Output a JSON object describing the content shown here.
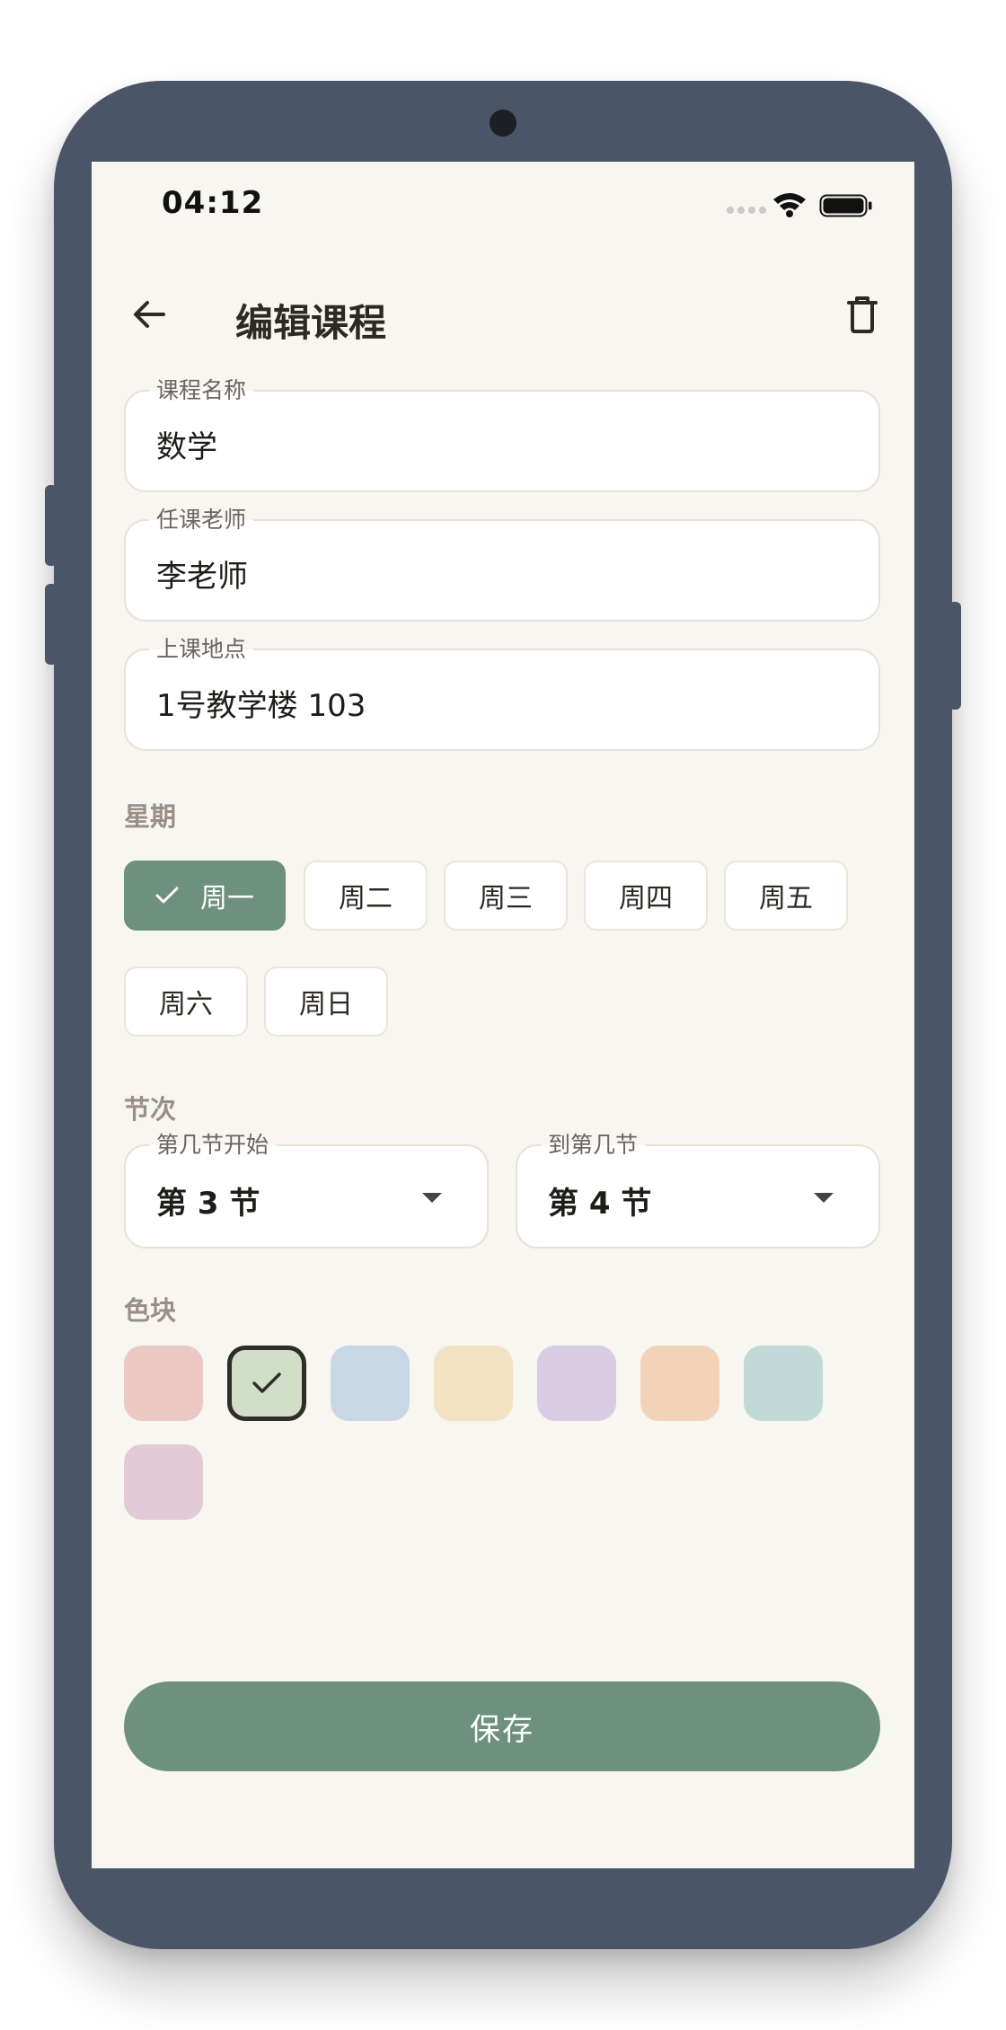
{
  "status_bar": {
    "time": "04:12"
  },
  "header": {
    "title": "编辑课程",
    "back_icon": "arrow-left-icon",
    "delete_icon": "trash-icon"
  },
  "fields": {
    "course_name": {
      "label": "课程名称",
      "value": "数学"
    },
    "teacher": {
      "label": "任课老师",
      "value": "李老师"
    },
    "location": {
      "label": "上课地点",
      "value": "1号教学楼 103"
    }
  },
  "weekday": {
    "title": "星期",
    "options": [
      "周一",
      "周二",
      "周三",
      "周四",
      "周五",
      "周六",
      "周日"
    ],
    "selected": "周一"
  },
  "periods": {
    "title": "节次",
    "start": {
      "label": "第几节开始",
      "value": "第 3 节"
    },
    "end": {
      "label": "到第几节",
      "value": "第 4 节"
    }
  },
  "colors": {
    "title": "色块",
    "swatches": [
      "#ecc9c5",
      "#d1dfc9",
      "#c9d6e4",
      "#f2e2c1",
      "#dacde3",
      "#f2d3b8",
      "#c1dad7",
      "#e2cbd6"
    ],
    "selected_index": 1
  },
  "save_label": "保存",
  "theme": {
    "accent": "#6e907e",
    "background": "#f8f6f1",
    "frame": "#4a5568"
  }
}
